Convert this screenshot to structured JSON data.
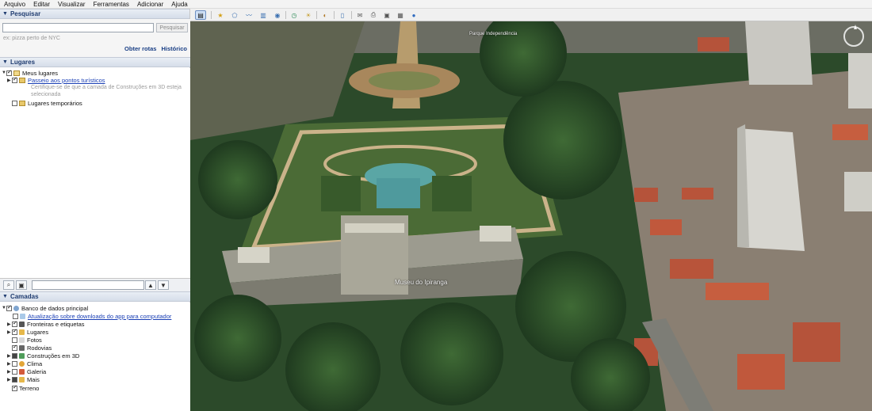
{
  "menu": [
    "Arquivo",
    "Editar",
    "Visualizar",
    "Ferramentas",
    "Adicionar",
    "Ajuda"
  ],
  "search": {
    "header": "Pesquisar",
    "button": "Pesquisar",
    "hint": "ex: pizza perto de NYC",
    "links": [
      "Obter rotas",
      "Histórico"
    ]
  },
  "places": {
    "header": "Lugares",
    "my_places": "Meus lugares",
    "tour": "Passeio aos pontos turísticos",
    "tour_note": "Certifique-se de que a camada de Construções em 3D esteja selecionada",
    "temp": "Lugares temporários"
  },
  "layers": {
    "header": "Camadas",
    "db": "Banco de dados principal",
    "update": "Atualização sobre downloads do app para computador",
    "items": [
      "Fronteiras e etiquetas",
      "Lugares",
      "Fotos",
      "Rodovias",
      "Construções em 3D",
      "Clima",
      "Galeria",
      "Mais"
    ],
    "terrain": "Terreno"
  },
  "map": {
    "labels": [
      "Museu do Ipiranga",
      "Parque Independência"
    ]
  },
  "icons": [
    "globe-icon",
    "star-icon",
    "polygon-icon",
    "path-icon",
    "overlay-icon",
    "tour-icon",
    "planet-icon",
    "sun-icon",
    "historical-imagery-icon",
    "ruler-icon",
    "email-icon",
    "print-icon",
    "save-image-icon",
    "map-view-icon",
    "earth-icon"
  ],
  "colors": {
    "accent": "#1f3c70",
    "link": "#1a3fb5"
  }
}
